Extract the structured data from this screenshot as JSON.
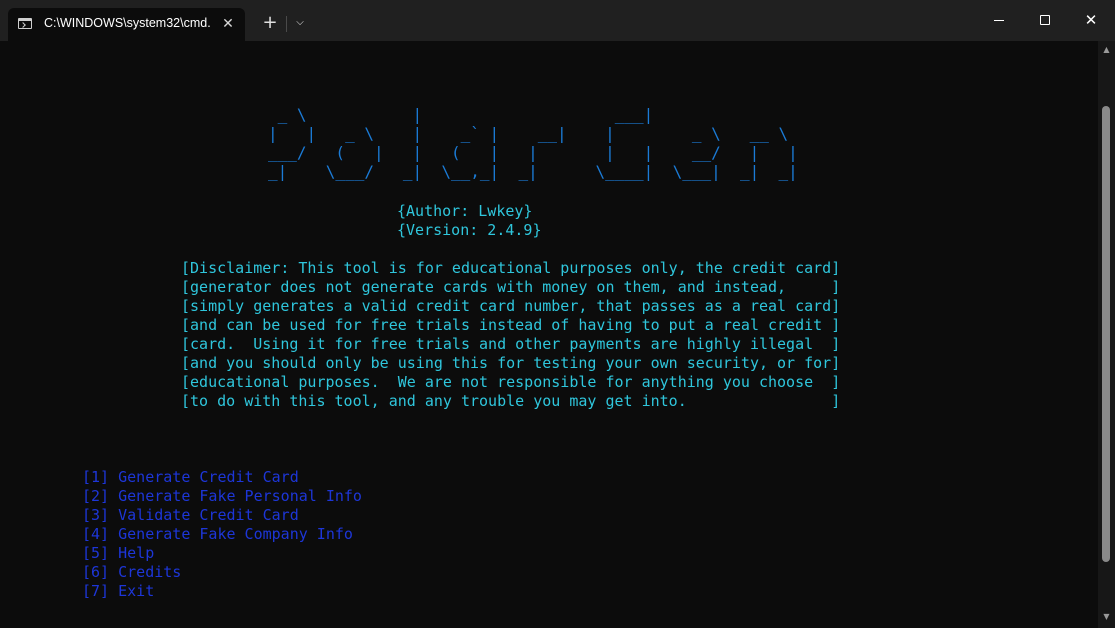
{
  "window": {
    "tab_title": "C:\\WINDOWS\\system32\\cmd.",
    "tab_icon": "console-icon",
    "close_tab_glyph": "✕",
    "new_tab_glyph": "+",
    "dropdown_glyph": "⌵",
    "close_glyph": "✕"
  },
  "terminal": {
    "banner_art": " _ \\           |                    ___|\n|   |   _ \\    |    _` |    __|    |        _ \\   __ \\\n___/   (   |   |   (   |   |       |   |    __/   |   |\n_|    \\___/   _|  \\__,_|  _|      \\____|  \\___|  _|  _|",
    "author_line": "{Author: Lwkey}",
    "version_line": "{Version: 2.4.9}",
    "disclaimer_lines": [
      "[Disclaimer: This tool is for educational purposes only, the credit card]",
      "[generator does not generate cards with money on them, and instead,     ]",
      "[simply generates a valid credit card number, that passes as a real card]",
      "[and can be used for free trials instead of having to put a real credit ]",
      "[card.  Using it for free trials and other payments are highly illegal  ]",
      "[and you should only be using this for testing your own security, or for]",
      "[educational purposes.  We are not responsible for anything you choose  ]",
      "[to do with this tool, and any trouble you may get into.                ]"
    ],
    "menu_items": [
      "[1] Generate Credit Card",
      "[2] Generate Fake Personal Info",
      "[3] Validate Credit Card",
      "[4] Generate Fake Company Info",
      "[5] Help",
      "[6] Credits",
      "[7] Exit"
    ]
  },
  "colors": {
    "background": "#0c0c0c",
    "banner": "#1b7bd6",
    "info_text": "#2fc6dc",
    "menu_text": "#1d36d8",
    "titlebar": "#202020"
  },
  "scrollbar": {
    "up_glyph": "▲",
    "down_glyph": "▼"
  }
}
